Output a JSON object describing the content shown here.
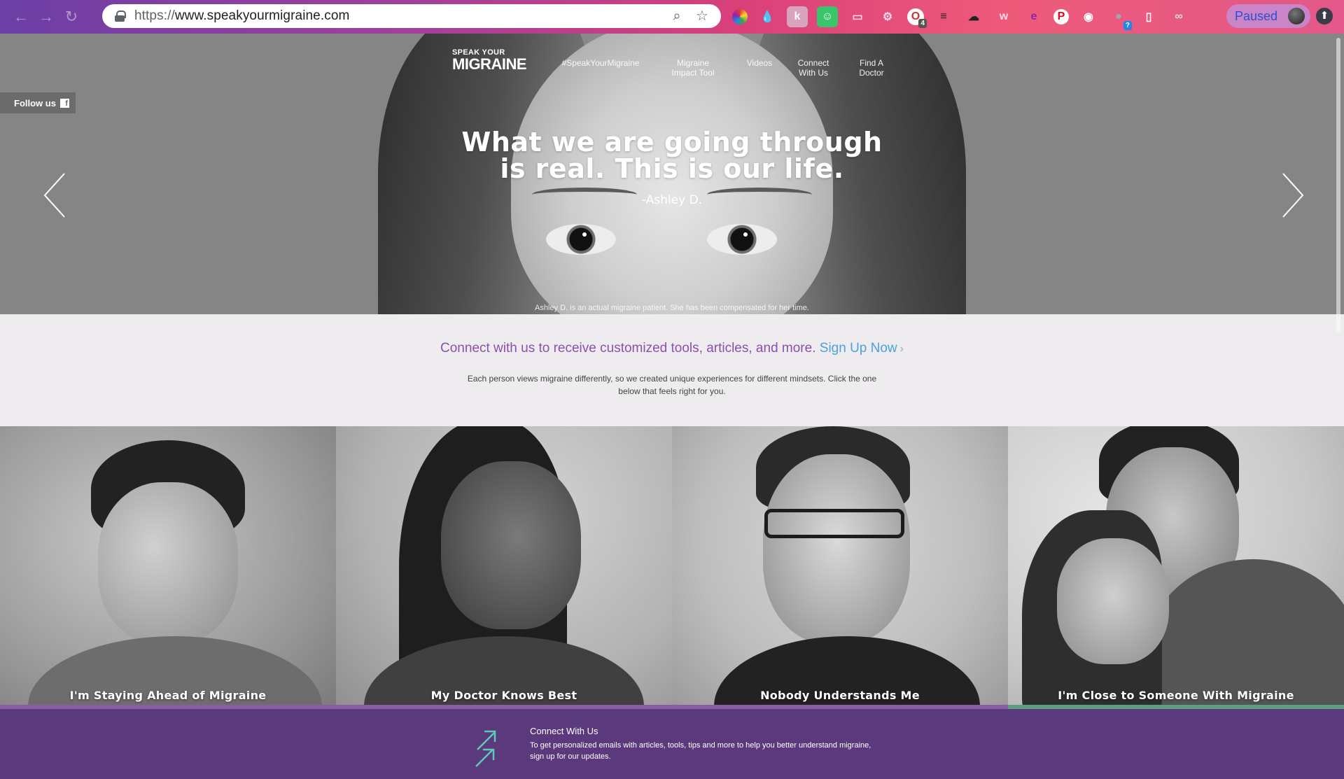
{
  "browser": {
    "url_scheme": "https://",
    "url_host": "www.speakyourmigraine.com",
    "paused_label": "Paused",
    "ext_badges": {
      "ext5": "4",
      "ext13": "?"
    }
  },
  "nav": {
    "logo_small": "SPEAK YOUR",
    "logo_big": "MIGRAINE",
    "links": [
      {
        "line1": "#SpeakYourMigraine",
        "line2": ""
      },
      {
        "line1": "Migraine",
        "line2": "Impact Tool"
      },
      {
        "line1": "Videos",
        "line2": ""
      },
      {
        "line1": "Connect",
        "line2": "With Us"
      },
      {
        "line1": "Find A",
        "line2": "Doctor"
      }
    ]
  },
  "follow": {
    "label": "Follow us",
    "icon": "f"
  },
  "hero": {
    "quote_line1": "What we are going through",
    "quote_line2": "is real. This is our life.",
    "attribution": "-Ashley D.",
    "disclaimer": "Ashley D. is an actual migraine patient. She has been compensated for her time."
  },
  "connect": {
    "text": "Connect with us to receive customized tools, articles, and more.",
    "signup": "Sign Up Now",
    "chevron": "›",
    "description": "Each person views migraine differently, so we created unique experiences for different mindsets. Click the one below that feels right for you."
  },
  "mindsets": [
    {
      "caption": "I'm Staying Ahead of Migraine",
      "accent": "#8a5ca8"
    },
    {
      "caption": "My Doctor Knows Best",
      "accent": "#8a5ca8"
    },
    {
      "caption": "Nobody Understands Me",
      "accent": "#8a5ca8"
    },
    {
      "caption": "I'm Close to Someone With Migraine",
      "accent": "#5e9e7e"
    }
  ],
  "footer": {
    "title": "Connect With Us",
    "text": "To get personalized emails with articles, tools, tips and more to help you better understand migraine, sign up for our updates."
  },
  "colors": {
    "brand_purple": "#8c4fb0",
    "link_blue": "#4aa3df",
    "footer_purple": "#5a3a7c"
  }
}
